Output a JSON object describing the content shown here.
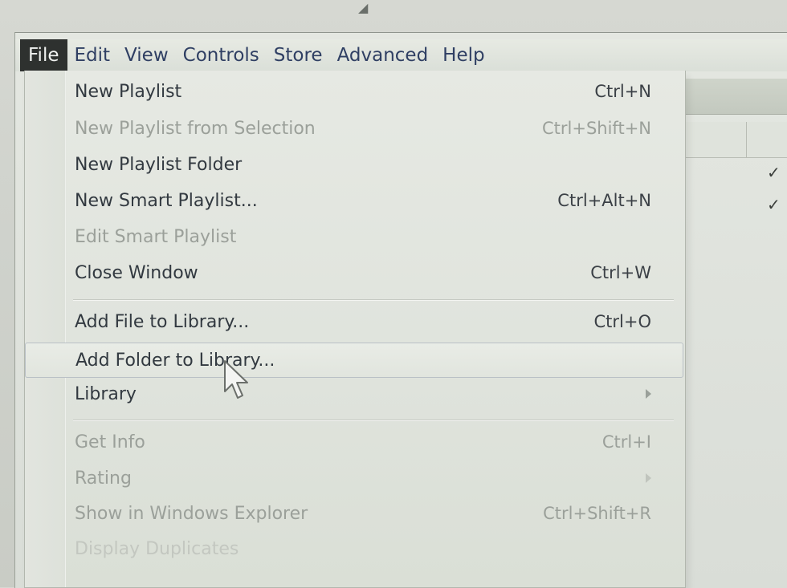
{
  "menubar": {
    "items": [
      {
        "label": "File"
      },
      {
        "label": "Edit"
      },
      {
        "label": "View"
      },
      {
        "label": "Controls"
      },
      {
        "label": "Store"
      },
      {
        "label": "Advanced"
      },
      {
        "label": "Help"
      }
    ]
  },
  "file_menu": {
    "items": [
      {
        "label": "New Playlist",
        "shortcut": "Ctrl+N"
      },
      {
        "label": "New Playlist from Selection",
        "shortcut": "Ctrl+Shift+N"
      },
      {
        "label": "New Playlist Folder",
        "shortcut": ""
      },
      {
        "label": "New Smart Playlist...",
        "shortcut": "Ctrl+Alt+N"
      },
      {
        "label": "Edit Smart Playlist",
        "shortcut": ""
      },
      {
        "label": "Close Window",
        "shortcut": "Ctrl+W"
      },
      {
        "label": "Add File to Library...",
        "shortcut": "Ctrl+O"
      },
      {
        "label": "Add Folder to Library...",
        "shortcut": ""
      },
      {
        "label": "Library",
        "shortcut": ""
      },
      {
        "label": "Get Info",
        "shortcut": "Ctrl+I"
      },
      {
        "label": "Rating",
        "shortcut": ""
      },
      {
        "label": "Show in Windows Explorer",
        "shortcut": "Ctrl+Shift+R"
      },
      {
        "label": "Display Duplicates",
        "shortcut": ""
      }
    ]
  },
  "background_list": {
    "check_1": "✓",
    "check_2": "✓"
  },
  "colors": {
    "active_menu_bg": "#2e312f",
    "menu_text": "#2f3f63",
    "disabled_text": "#9ba09a"
  }
}
